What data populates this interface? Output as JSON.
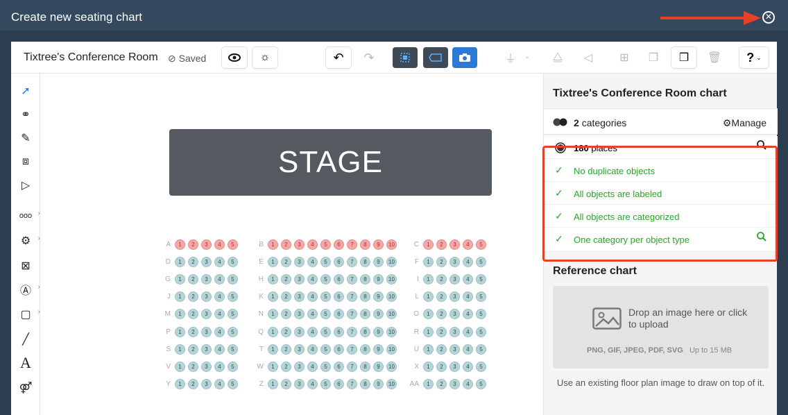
{
  "window": {
    "title": "Create new seating chart"
  },
  "toolbar": {
    "chart_name": "Tixtree's Conference Room",
    "saved_label": "Saved"
  },
  "stage_label": "STAGE",
  "sections": [
    {
      "rows": [
        {
          "label": "A",
          "seats": [
            "1",
            "2",
            "3",
            "4",
            "5"
          ],
          "color": "red"
        },
        {
          "label": "D",
          "seats": [
            "1",
            "2",
            "3",
            "4",
            "5"
          ],
          "color": "teal"
        },
        {
          "label": "G",
          "seats": [
            "1",
            "2",
            "3",
            "4",
            "5"
          ],
          "color": "teal"
        },
        {
          "label": "J",
          "seats": [
            "1",
            "2",
            "3",
            "4",
            "5"
          ],
          "color": "teal"
        },
        {
          "label": "M",
          "seats": [
            "1",
            "2",
            "3",
            "4",
            "5"
          ],
          "color": "teal"
        },
        {
          "label": "P",
          "seats": [
            "1",
            "2",
            "3",
            "4",
            "5"
          ],
          "color": "teal"
        },
        {
          "label": "S",
          "seats": [
            "1",
            "2",
            "3",
            "4",
            "5"
          ],
          "color": "teal"
        },
        {
          "label": "V",
          "seats": [
            "1",
            "2",
            "3",
            "4",
            "5"
          ],
          "color": "teal"
        },
        {
          "label": "Y",
          "seats": [
            "1",
            "2",
            "3",
            "4",
            "5"
          ],
          "color": "teal"
        }
      ]
    },
    {
      "rows": [
        {
          "label": "B",
          "seats": [
            "1",
            "2",
            "3",
            "4",
            "5",
            "6",
            "7",
            "8",
            "9",
            "10"
          ],
          "color": "red"
        },
        {
          "label": "E",
          "seats": [
            "1",
            "2",
            "3",
            "4",
            "5",
            "6",
            "7",
            "8",
            "9",
            "10"
          ],
          "color": "teal"
        },
        {
          "label": "H",
          "seats": [
            "1",
            "2",
            "3",
            "4",
            "5",
            "6",
            "7",
            "8",
            "9",
            "10"
          ],
          "color": "teal"
        },
        {
          "label": "K",
          "seats": [
            "1",
            "2",
            "3",
            "4",
            "5",
            "6",
            "7",
            "8",
            "9",
            "10"
          ],
          "color": "teal"
        },
        {
          "label": "N",
          "seats": [
            "1",
            "2",
            "3",
            "4",
            "5",
            "6",
            "7",
            "8",
            "9",
            "10"
          ],
          "color": "teal"
        },
        {
          "label": "Q",
          "seats": [
            "1",
            "2",
            "3",
            "4",
            "5",
            "6",
            "7",
            "8",
            "9",
            "10"
          ],
          "color": "teal"
        },
        {
          "label": "T",
          "seats": [
            "1",
            "2",
            "3",
            "4",
            "5",
            "6",
            "7",
            "8",
            "9",
            "10"
          ],
          "color": "teal"
        },
        {
          "label": "W",
          "seats": [
            "1",
            "2",
            "3",
            "4",
            "5",
            "6",
            "7",
            "8",
            "9",
            "10"
          ],
          "color": "teal"
        },
        {
          "label": "Z",
          "seats": [
            "1",
            "2",
            "3",
            "4",
            "5",
            "6",
            "7",
            "8",
            "9",
            "10"
          ],
          "color": "teal"
        }
      ]
    },
    {
      "rows": [
        {
          "label": "C",
          "seats": [
            "1",
            "2",
            "3",
            "4",
            "5"
          ],
          "color": "red"
        },
        {
          "label": "F",
          "seats": [
            "1",
            "2",
            "3",
            "4",
            "5"
          ],
          "color": "teal"
        },
        {
          "label": "I",
          "seats": [
            "1",
            "2",
            "3",
            "4",
            "5"
          ],
          "color": "teal"
        },
        {
          "label": "L",
          "seats": [
            "1",
            "2",
            "3",
            "4",
            "5"
          ],
          "color": "teal"
        },
        {
          "label": "O",
          "seats": [
            "1",
            "2",
            "3",
            "4",
            "5"
          ],
          "color": "teal"
        },
        {
          "label": "R",
          "seats": [
            "1",
            "2",
            "3",
            "4",
            "5"
          ],
          "color": "teal"
        },
        {
          "label": "U",
          "seats": [
            "1",
            "2",
            "3",
            "4",
            "5"
          ],
          "color": "teal"
        },
        {
          "label": "X",
          "seats": [
            "1",
            "2",
            "3",
            "4",
            "5"
          ],
          "color": "teal"
        },
        {
          "label": "AA",
          "seats": [
            "1",
            "2",
            "3",
            "4",
            "5"
          ],
          "color": "teal"
        }
      ]
    }
  ],
  "panel": {
    "title": "Tixtree's Conference Room chart",
    "categories_count": "2",
    "categories_label": "categories",
    "manage_label": "Manage",
    "places_count": "180",
    "places_label": "places",
    "checks": [
      "No duplicate objects",
      "All objects are labeled",
      "All objects are categorized",
      "One category per object type"
    ],
    "reference_title": "Reference chart",
    "drop_text": "Drop an image here or click to upload",
    "formats": "PNG, GIF, JPEG, PDF, SVG",
    "size_limit": "Up to 15 MB",
    "reference_note": "Use an existing floor plan image to draw on top of it."
  },
  "colors": {
    "highlight": "#e8412a",
    "ok": "#2aa52a",
    "seat_red": "#f4a7a7",
    "seat_teal": "#b6d3d6"
  }
}
